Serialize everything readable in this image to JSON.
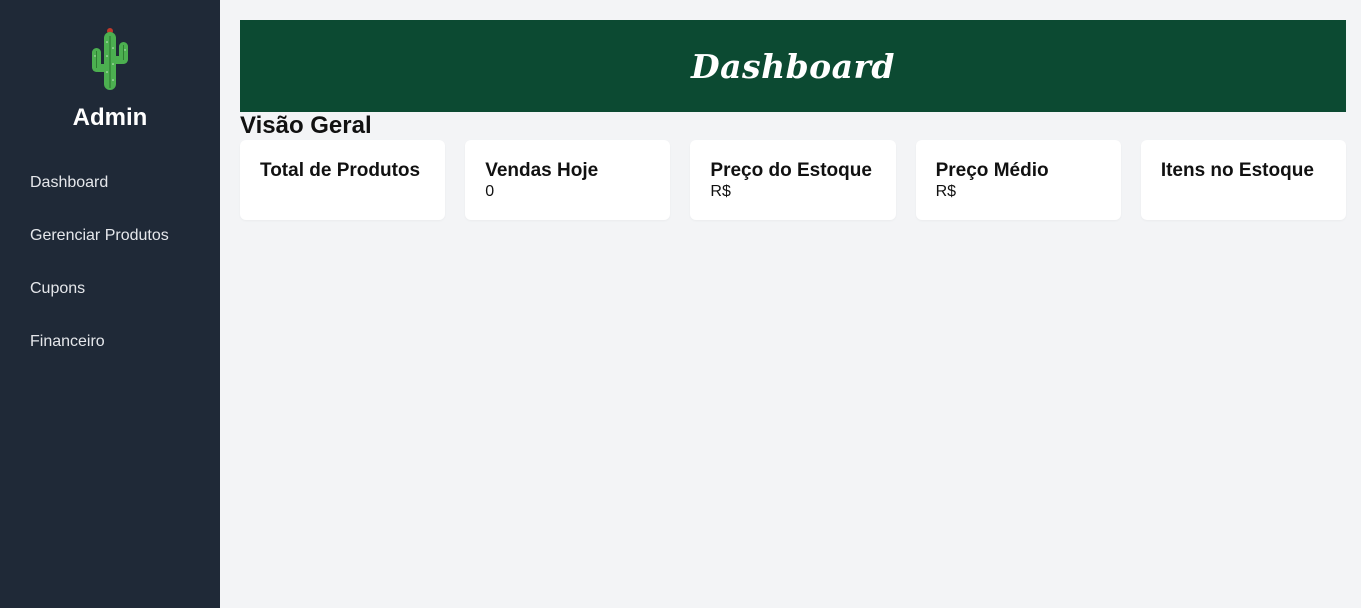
{
  "sidebar": {
    "logo_icon": "cactus-icon",
    "brand": "Admin",
    "items": [
      {
        "label": "Dashboard"
      },
      {
        "label": "Gerenciar Produtos"
      },
      {
        "label": "Cupons"
      },
      {
        "label": "Financeiro"
      }
    ]
  },
  "header": {
    "title": "Dashboard",
    "background": "#0c4a32"
  },
  "overview": {
    "title": "Visão Geral",
    "cards": [
      {
        "title": "Total de Produtos",
        "value": ""
      },
      {
        "title": "Vendas Hoje",
        "value": "0"
      },
      {
        "title": "Preço do Estoque",
        "value": "R$"
      },
      {
        "title": "Preço Médio",
        "value": "R$"
      },
      {
        "title": "Itens no Estoque",
        "value": ""
      }
    ]
  },
  "colors": {
    "sidebar_bg": "#1f2937",
    "page_bg": "#f3f4f6",
    "cactus_green": "#4caf50"
  }
}
